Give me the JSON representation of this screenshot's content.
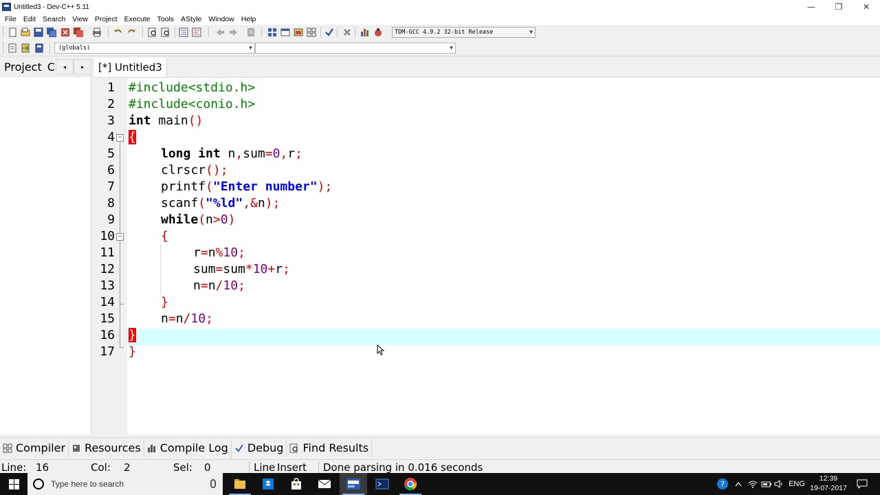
{
  "window": {
    "title": "Untitled3 - Dev-C++ 5.11",
    "minimize": "—",
    "restore": "❐",
    "close": "✕"
  },
  "menu": [
    "File",
    "Edit",
    "Search",
    "View",
    "Project",
    "Execute",
    "Tools",
    "AStyle",
    "Window",
    "Help"
  ],
  "toolbar": {
    "compiler_select": "TDM-GCC 4.9.2 32-bit Release",
    "scope_combo": "(globals)",
    "member_combo": ""
  },
  "left_panel": {
    "tab_project": "Project",
    "tab_classes_cut": "C",
    "scroll_left": "◂",
    "scroll_right": "▸"
  },
  "editor": {
    "tab_label": "[*] Untitled3",
    "active_line": 16,
    "lines": [
      {
        "n": "1"
      },
      {
        "n": "2"
      },
      {
        "n": "3"
      },
      {
        "n": "4"
      },
      {
        "n": "5"
      },
      {
        "n": "6"
      },
      {
        "n": "7"
      },
      {
        "n": "8"
      },
      {
        "n": "9"
      },
      {
        "n": "10"
      },
      {
        "n": "11"
      },
      {
        "n": "12"
      },
      {
        "n": "13"
      },
      {
        "n": "14"
      },
      {
        "n": "15"
      },
      {
        "n": "16"
      },
      {
        "n": "17"
      }
    ],
    "code": {
      "l1": "#include<stdio.h>",
      "l2": "#include<conio.h>",
      "l3_kw": "int",
      "l3_rest": " main",
      "l3_sym": "()",
      "l4": "{",
      "l5_kw": "long int",
      "l5_a": " n",
      "l5_b": ",",
      "l5_c": "sum",
      "l5_d": "=",
      "l5_e": "0",
      "l5_f": ",",
      "l5_g": "r",
      "l5_h": ";",
      "l6_a": "clrscr",
      "l6_b": "();",
      "l7_a": "printf",
      "l7_b": "(",
      "l7_str": "\"Enter number\"",
      "l7_c": ");",
      "l8_a": "scanf",
      "l8_b": "(",
      "l8_str": "\"%ld\"",
      "l8_c": ",&",
      "l8_d": "n",
      "l8_e": ");",
      "l9_kw": "while",
      "l9_a": "(",
      "l9_b": "n",
      "l9_c": ">",
      "l9_d": "0",
      "l9_e": ")",
      "l10": "{",
      "l11_a": "r",
      "l11_b": "=",
      "l11_c": "n",
      "l11_d": "%",
      "l11_e": "10",
      "l11_f": ";",
      "l12_a": "sum",
      "l12_b": "=",
      "l12_c": "sum",
      "l12_d": "*",
      "l12_e": "10",
      "l12_f": "+",
      "l12_g": "r",
      "l12_h": ";",
      "l13_a": "n",
      "l13_b": "=",
      "l13_c": "n",
      "l13_d": "/",
      "l13_e": "10",
      "l13_f": ";",
      "l14": "}",
      "l15_a": "n",
      "l15_b": "=",
      "l15_c": "n",
      "l15_d": "/",
      "l15_e": "10",
      "l15_f": ";",
      "l16": "}",
      "l17": "}"
    }
  },
  "bottom_tabs": [
    {
      "label": "Compiler",
      "icon": "grid-icon"
    },
    {
      "label": "Resources",
      "icon": "resources-icon"
    },
    {
      "label": "Compile Log",
      "icon": "chart-icon"
    },
    {
      "label": "Debug",
      "icon": "check-icon"
    },
    {
      "label": "Find Results",
      "icon": "find-icon"
    }
  ],
  "status": {
    "line_label": "Line:",
    "line_value": "16",
    "col_label": "Col:",
    "col_value": "2",
    "sel_label": "Sel:",
    "sel_value": "0",
    "lines_label": "Line",
    "mode": "Insert",
    "message": "Done parsing in 0.016 seconds"
  },
  "taskbar": {
    "search_placeholder": "Type here to search",
    "lang": "ENG",
    "time": "12:39",
    "date": "19-07-2017"
  }
}
